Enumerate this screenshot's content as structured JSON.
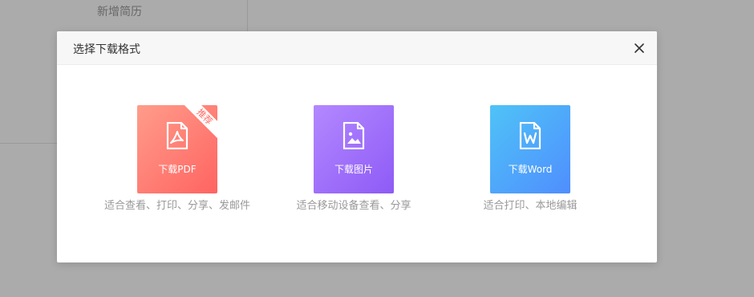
{
  "background": {
    "add_resume": "新增简历"
  },
  "dialog": {
    "title": "选择下载格式",
    "close_icon": "close-icon",
    "options": [
      {
        "label": "下载PDF",
        "badge": "推荐",
        "description": "适合查看、打印、分享、发邮件",
        "icon": "pdf-file-icon",
        "color_from": "#ff9c8a",
        "color_to": "#ff6462"
      },
      {
        "label": "下载图片",
        "description": "适合移动设备查看、分享",
        "icon": "image-file-icon",
        "color_from": "#b388ff",
        "color_to": "#8e5bf6"
      },
      {
        "label": "下载Word",
        "description": "适合打印、本地编辑",
        "icon": "word-file-icon",
        "color_from": "#4fc3f7",
        "color_to": "#4f8efe"
      }
    ]
  }
}
